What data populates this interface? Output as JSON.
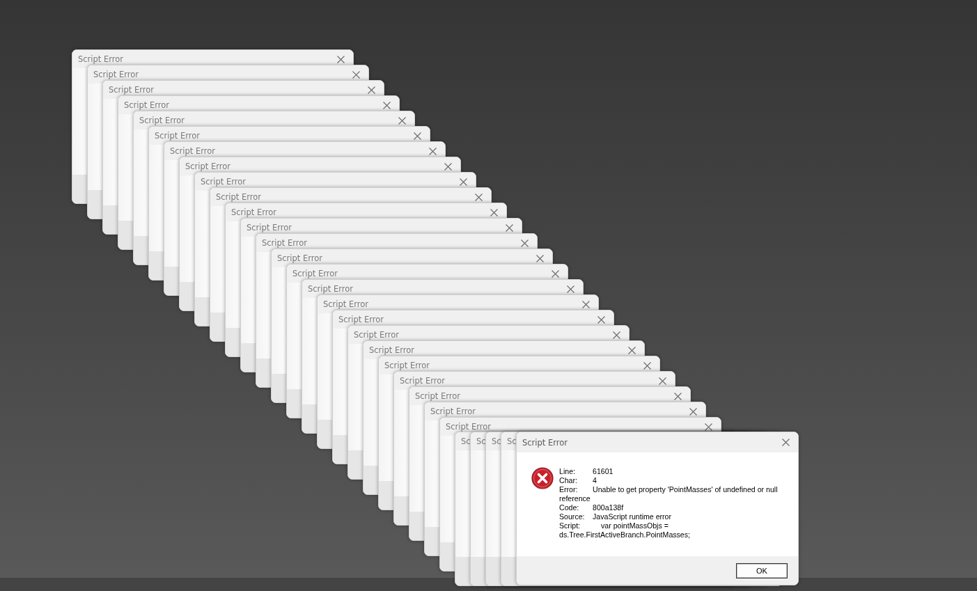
{
  "cascade_windows": [
    {
      "title": "Script Error"
    },
    {
      "title": "Script Error"
    },
    {
      "title": "Script Error"
    },
    {
      "title": "Script Error"
    },
    {
      "title": "Script Error"
    },
    {
      "title": "Script Error"
    },
    {
      "title": "Script Error"
    },
    {
      "title": "Script Error"
    },
    {
      "title": "Script Error"
    },
    {
      "title": "Script Error"
    },
    {
      "title": "Script Error"
    },
    {
      "title": "Script Error"
    },
    {
      "title": "Script Error"
    },
    {
      "title": "Script Error"
    },
    {
      "title": "Script Error"
    },
    {
      "title": "Script Error"
    },
    {
      "title": "Script Error"
    },
    {
      "title": "Script Error"
    },
    {
      "title": "Script Error"
    },
    {
      "title": "Script Error"
    },
    {
      "title": "Script Error"
    },
    {
      "title": "Script Error"
    },
    {
      "title": "Script Error"
    },
    {
      "title": "Script Error"
    },
    {
      "title": "Script Error"
    }
  ],
  "stacked_windows": [
    {
      "title": "Sc"
    },
    {
      "title": "Sc"
    },
    {
      "title": "Sc"
    },
    {
      "title": "Sc"
    }
  ],
  "active_window": {
    "title": "Script Error",
    "fields": [
      {
        "label": "Line:",
        "value": "61601"
      },
      {
        "label": "Char:",
        "value": "4"
      },
      {
        "label": "Error:",
        "value": "Unable to get property 'PointMasses' of undefined or null reference"
      },
      {
        "label": "Code:",
        "value": "800a138f"
      },
      {
        "label": "Source:",
        "value": "JavaScript runtime error"
      },
      {
        "label": "Script:",
        "value": "var pointMassObjs = ds.Tree.FirstActiveBranch.PointMasses;",
        "indented": true
      }
    ],
    "button": "OK"
  }
}
